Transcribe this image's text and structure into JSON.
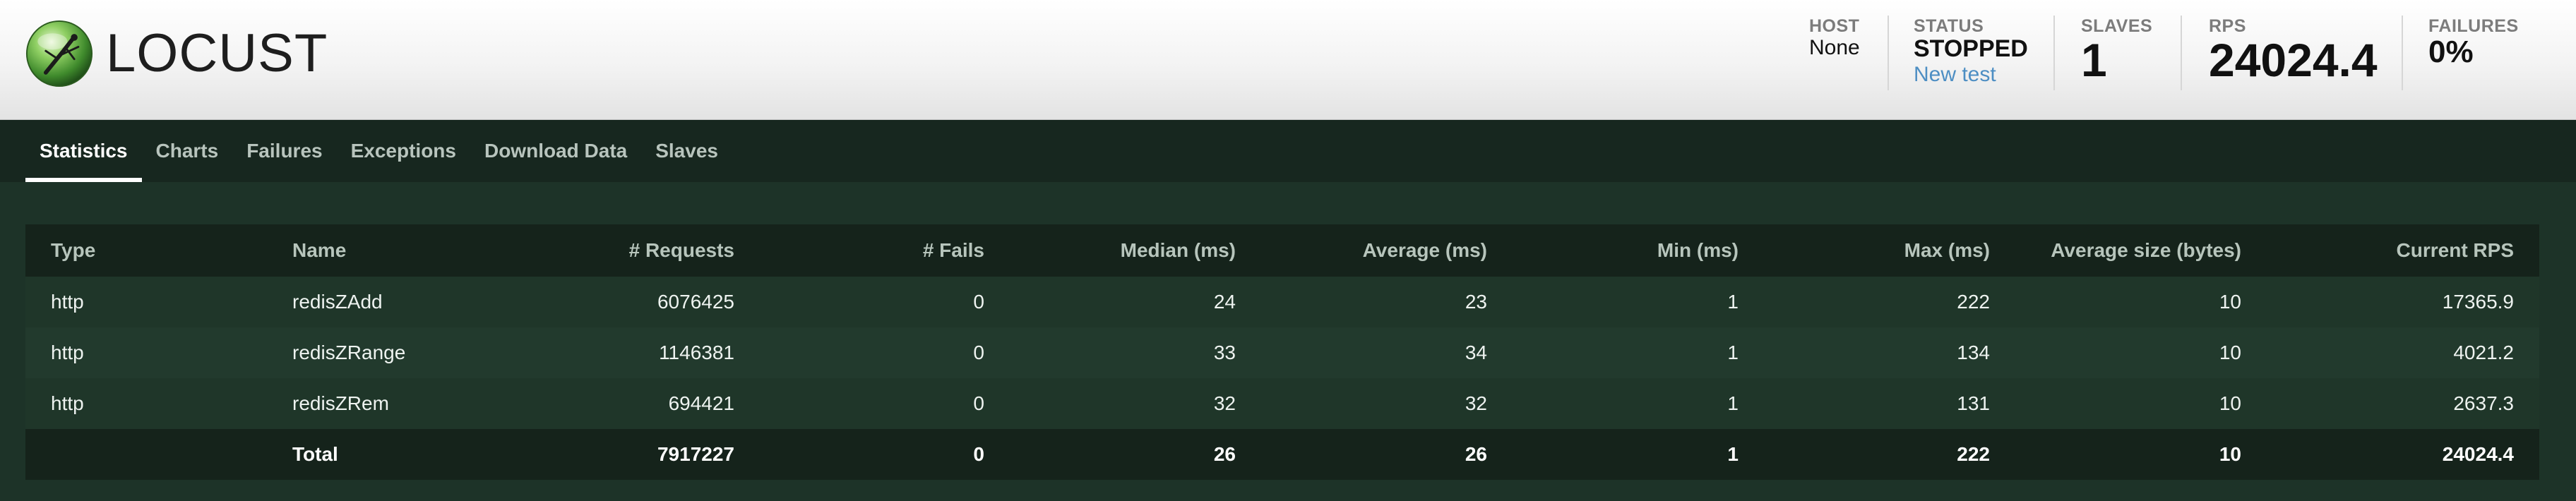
{
  "app": {
    "logo_text": "LOCUST",
    "logo_icon": "locust-insect-globe-icon"
  },
  "header": {
    "host": {
      "label": "HOST",
      "value": "None"
    },
    "status": {
      "label": "STATUS",
      "value": "STOPPED",
      "link": "New test"
    },
    "slaves": {
      "label": "SLAVES",
      "value": "1"
    },
    "rps": {
      "label": "RPS",
      "value": "24024.4"
    },
    "failures": {
      "label": "FAILURES",
      "value": "0%"
    }
  },
  "tabs": [
    {
      "label": "Statistics",
      "active": true
    },
    {
      "label": "Charts"
    },
    {
      "label": "Failures"
    },
    {
      "label": "Exceptions"
    },
    {
      "label": "Download Data"
    },
    {
      "label": "Slaves"
    }
  ],
  "table": {
    "columns": [
      "Type",
      "Name",
      "# Requests",
      "# Fails",
      "Median (ms)",
      "Average (ms)",
      "Min (ms)",
      "Max (ms)",
      "Average size (bytes)",
      "Current RPS"
    ],
    "rows": [
      [
        "http",
        "redisZAdd",
        "6076425",
        "0",
        "24",
        "23",
        "1",
        "222",
        "10",
        "17365.9"
      ],
      [
        "http",
        "redisZRange",
        "1146381",
        "0",
        "33",
        "34",
        "1",
        "134",
        "10",
        "4021.2"
      ],
      [
        "http",
        "redisZRem",
        "694421",
        "0",
        "32",
        "32",
        "1",
        "131",
        "10",
        "2637.3"
      ]
    ],
    "total": [
      "",
      "Total",
      "7917227",
      "0",
      "26",
      "26",
      "1",
      "222",
      "10",
      "24024.4"
    ]
  },
  "colors": {
    "header_bg": "#f3f3f3",
    "nav_bg": "#17271f",
    "page_bg": "#1d3328",
    "table_head_bg": "#15231b",
    "row_bg": "#1f3629",
    "link": "#4d8ec3"
  }
}
